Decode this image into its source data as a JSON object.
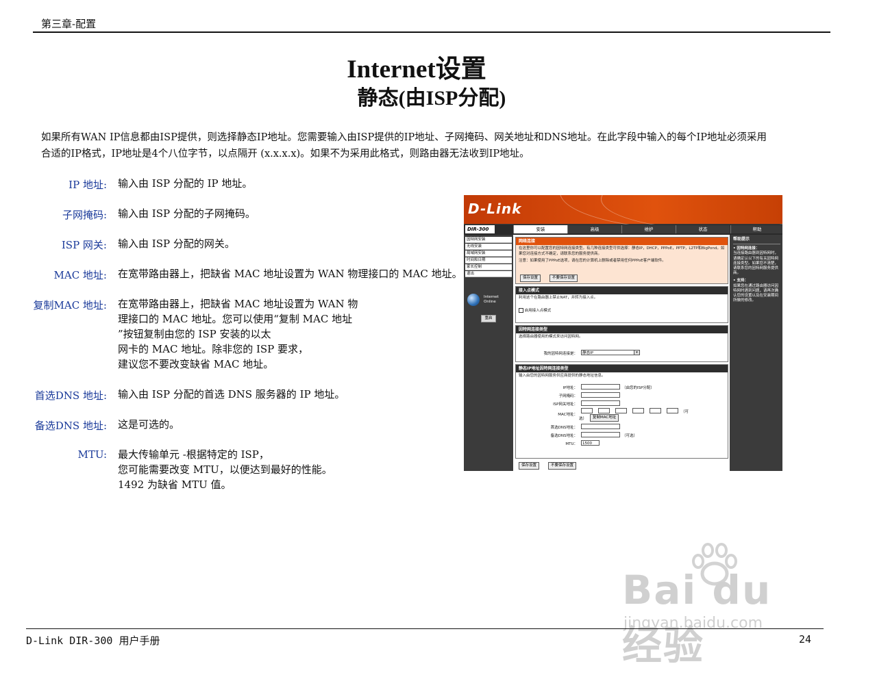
{
  "header": {
    "chapter": "第三章-配置"
  },
  "title": "Internet设置",
  "subtitle": "静态(由ISP分配)",
  "intro": [
    "如果所有WAN IP信息都由ISP提供，则选择静态IP地址。您需要输入由ISP提供的IP地址、子网掩码、网关地址和DNS地址。在此字段中输入的每个IP地址必须采用",
    "合适的IP格式，IP地址是4个八位字节，以点隔开 (x.x.x.x)。如果不为采用此格式，则路由器无法收到IP地址。"
  ],
  "definitions": [
    {
      "label": "IP 地址:",
      "lines": [
        "输入由 ISP 分配的 IP 地址。"
      ]
    },
    {
      "label": "子网掩码:",
      "lines": [
        "输入由 ISP 分配的子网掩码。"
      ]
    },
    {
      "label": "ISP 网关:",
      "lines": [
        "输入由 ISP 分配的网关。"
      ]
    },
    {
      "label": "MAC 地址:",
      "lines": [
        "在宽带路由器上，把缺省 MAC 地址设置为 WAN 物理接口的 MAC 地址。"
      ]
    },
    {
      "label": "复制MAC 地址:",
      "lines": [
        "在宽带路由器上，把缺省 MAC 地址设置为 WAN 物",
        "理接口的 MAC 地址。您可以使用“复制 MAC 地址",
        "”按钮复制由您的 ISP 安装的以太",
        "网卡的 MAC 地址。除非您的 ISP 要求，",
        "建议您不要改变缺省 MAC 地址。"
      ]
    },
    {
      "label": "首选DNS 地址:",
      "lines": [
        "输入由 ISP 分配的首选 DNS 服务器的 IP 地址。"
      ]
    },
    {
      "label": "备选DNS 地址:",
      "lines": [
        "这是可选的。"
      ]
    },
    {
      "label": "MTU:",
      "lines": [
        "最大传输单元 -根据特定的 ISP，",
        "您可能需要改变 MTU，以便达到最好的性能。",
        "1492 为缺省 MTU 值。"
      ]
    }
  ],
  "footer": {
    "left": "D-Link DIR-300 用户手册",
    "page": "24"
  },
  "watermark": {
    "text": "Bai du 经验",
    "url": "jingyan.baidu.com"
  },
  "screenshot": {
    "brand": "D-Link",
    "model": "DIR-300",
    "tabs": [
      "安装",
      "高级",
      "维护",
      "状态",
      "帮助"
    ],
    "nav": [
      "因特网安装",
      "无线安装",
      "局域网安装",
      "时间和日期",
      "家长控制",
      "退出"
    ],
    "internet_label": "Internet\nOnline",
    "reboot": "重启",
    "sec1": {
      "title": "网络连接",
      "text": "在这里你可以配置您的因特网连接类型。有几种连接类型可供选择：静态IP，DHCP，PPPoE，PPTP，L2TP和BigPond。如果您对连接方式不确定，请联系您的服务提供商。",
      "note": "注意：如果使用了PPPoE选项，请在您的计算机上删除或者禁用任何PPPoE客户端软件。",
      "save": "保存设置",
      "nosave": "不要保存设置"
    },
    "sec2": {
      "title": "接入点模式",
      "text": "利用这个在路由器上禁止NAT，并转为接入点。",
      "checkbox": "启用接入点模式"
    },
    "sec3": {
      "title": "因特网连接类型",
      "text": "选择路由器使用的模式来访问因特网。",
      "label": "我的因特网连接是：",
      "value": "静态IP"
    },
    "sec4": {
      "title": "静态IP地址因特网连接类型",
      "text": "输入由您的因特网服务供应商提供的静态地址信息。",
      "fields": {
        "ip": "IP地址：",
        "ip_note": "（由您的ISP分配）",
        "mask": "子网掩码：",
        "gw": "ISP网关地址：",
        "mac": "MAC地址：",
        "mac_note": "（可",
        "mac_note2": "选）",
        "clone": "复制MAC地址",
        "dns1": "首选DNS地址：",
        "dns2": "备选DNS地址：",
        "dns2_note": "（可选）",
        "mtu": "MTU：",
        "mtu_value": "1500"
      }
    },
    "bottom_save": "保存设置",
    "bottom_nosave": "不要保存设置",
    "help": {
      "title": "帮助提示",
      "b1": "• 因特网连接：",
      "t1": "当连接路由器到因特网时，请确定认以下的有关因特网连接类型。如果您不清楚，请联系您的因特网服务提供商。",
      "b2": "• 支持：",
      "t2": "如果您在通过路由器访问因特网时遇到问题，请再次确认您的设置以及在安装期间所做的修改。"
    }
  }
}
